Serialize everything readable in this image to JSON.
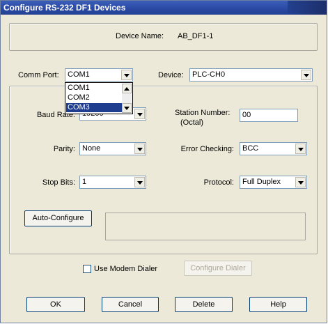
{
  "window": {
    "title": "Configure RS-232 DF1 Devices"
  },
  "device_name": {
    "label": "Device Name:",
    "value": "AB_DF1-1"
  },
  "comm_port": {
    "label": "Comm Port:",
    "selected": "COM1",
    "options": [
      "COM1",
      "COM2",
      "COM3"
    ],
    "highlighted": "COM3"
  },
  "device": {
    "label": "Device:",
    "selected": "PLC-CH0"
  },
  "baud_rate": {
    "label": "Baud Rate:",
    "selected": "19200"
  },
  "station_number": {
    "label_line1": "Station Number:",
    "label_line2": "(Octal)",
    "value": "00"
  },
  "parity": {
    "label": "Parity:",
    "selected": "None"
  },
  "error_checking": {
    "label": "Error Checking:",
    "selected": "BCC"
  },
  "stop_bits": {
    "label": "Stop Bits:",
    "selected": "1"
  },
  "protocol": {
    "label": "Protocol:",
    "selected": "Full Duplex"
  },
  "auto_configure": {
    "label": "Auto-Configure"
  },
  "modem": {
    "checkbox_label": "Use Modem Dialer",
    "checked": false,
    "configure_label": "Configure Dialer"
  },
  "footer": {
    "ok": "OK",
    "cancel": "Cancel",
    "delete": "Delete",
    "help": "Help"
  }
}
